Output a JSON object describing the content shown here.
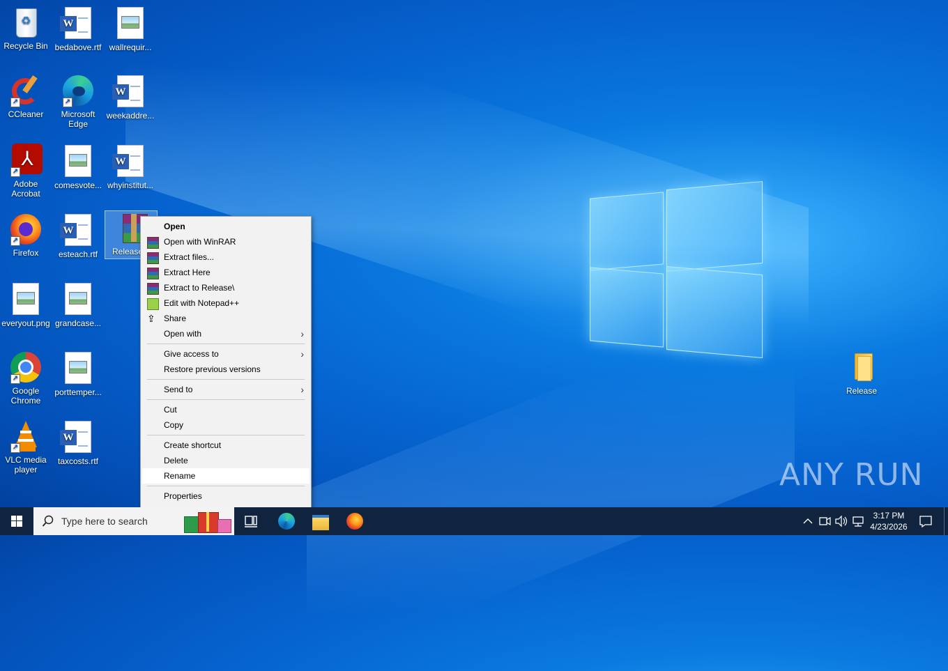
{
  "desktop": {
    "icons": [
      {
        "label": "Recycle Bin"
      },
      {
        "label": "bedabove.rtf"
      },
      {
        "label": "wallrequir..."
      },
      {
        "label": "CCleaner"
      },
      {
        "label": "Microsoft Edge"
      },
      {
        "label": "weekaddre..."
      },
      {
        "label": "Adobe Acrobat"
      },
      {
        "label": "comesvote..."
      },
      {
        "label": "whyinstitut..."
      },
      {
        "label": "Firefox"
      },
      {
        "label": "esteach.rtf"
      },
      {
        "label": "Release..."
      },
      {
        "label": "everyout.png"
      },
      {
        "label": "grandcase..."
      },
      {
        "label": "Google Chrome"
      },
      {
        "label": "porttemper..."
      },
      {
        "label": "VLC media player"
      },
      {
        "label": "taxcosts.rtf"
      },
      {
        "label": "Release"
      }
    ]
  },
  "context_menu": {
    "items": [
      {
        "label": "Open"
      },
      {
        "label": "Open with WinRAR"
      },
      {
        "label": "Extract files..."
      },
      {
        "label": "Extract Here"
      },
      {
        "label": "Extract to Release\\"
      },
      {
        "label": "Edit with Notepad++"
      },
      {
        "label": "Share"
      },
      {
        "label": "Open with"
      },
      {
        "label": "Give access to"
      },
      {
        "label": "Restore previous versions"
      },
      {
        "label": "Send to"
      },
      {
        "label": "Cut"
      },
      {
        "label": "Copy"
      },
      {
        "label": "Create shortcut"
      },
      {
        "label": "Delete"
      },
      {
        "label": "Rename"
      },
      {
        "label": "Properties"
      }
    ]
  },
  "taskbar": {
    "search_placeholder": "Type here to search",
    "time": "3:17 PM",
    "date": "4/23/2026"
  },
  "watermark": "ANY RUN"
}
